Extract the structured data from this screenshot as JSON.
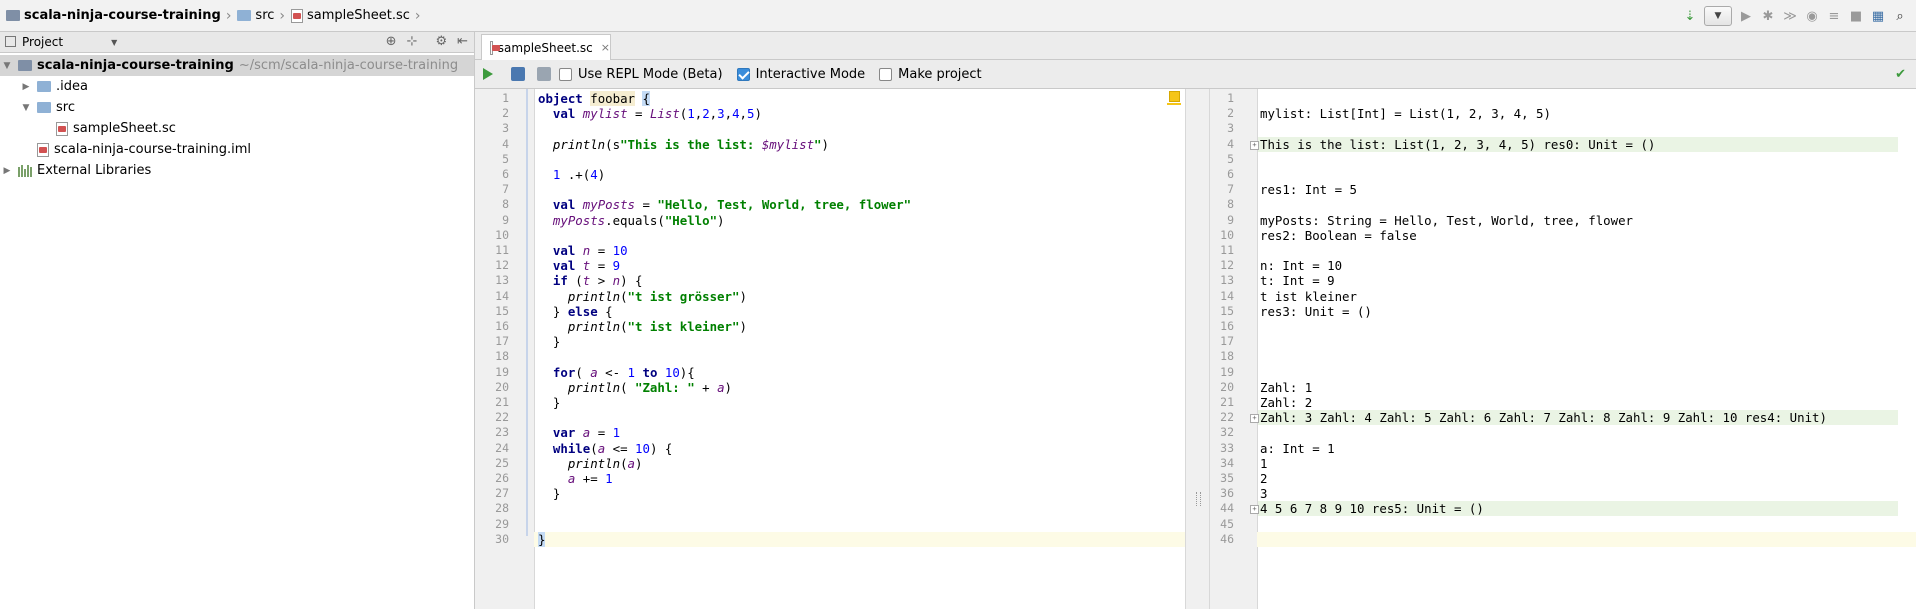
{
  "breadcrumb": {
    "project": "scala-ninja-course-training",
    "folder": "src",
    "file": "sampleSheet.sc"
  },
  "project_panel": {
    "title": "Project",
    "tree": [
      {
        "label": "scala-ninja-course-training",
        "path": "~/scm/scala-ninja-course-training",
        "icon": "project-folder-icon",
        "expanded": true
      },
      {
        "label": ".idea",
        "icon": "folder-icon",
        "expanded": false
      },
      {
        "label": "src",
        "icon": "folder-icon",
        "expanded": true
      },
      {
        "label": "sampleSheet.sc",
        "icon": "scala-worksheet-icon"
      },
      {
        "label": "scala-ninja-course-training.iml",
        "icon": "module-file-icon"
      },
      {
        "label": "External Libraries",
        "icon": "libraries-icon",
        "expanded": false
      }
    ]
  },
  "editor_tab": {
    "label": "sampleSheet.sc",
    "close": "×"
  },
  "worksheet_toolbar": {
    "repl_mode_label": "Use REPL Mode (Beta)",
    "repl_mode_checked": false,
    "interactive_mode_label": "Interactive Mode",
    "interactive_mode_checked": true,
    "make_project_label": "Make project",
    "make_project_checked": false
  },
  "source": {
    "line_numbers": [
      "1",
      "2",
      "3",
      "4",
      "5",
      "6",
      "7",
      "8",
      "9",
      "10",
      "11",
      "12",
      "13",
      "14",
      "15",
      "16",
      "17",
      "18",
      "19",
      "20",
      "21",
      "22",
      "23",
      "24",
      "25",
      "26",
      "27",
      "28",
      "29",
      "30"
    ],
    "lines": [
      "object foobar {",
      "  val mylist = List(1,2,3,4,5)",
      "",
      "  println(s\"This is the list: $mylist\")",
      "",
      "  1 .+(4)",
      "",
      "  val myPosts = \"Hello, Test, World, tree, flower\"",
      "  myPosts.equals(\"Hello\")",
      "",
      "  val n = 10",
      "  val t = 9",
      "  if (t > n) {",
      "    println(\"t ist grösser\")",
      "  } else {",
      "    println(\"t ist kleiner\")",
      "  }",
      "",
      "  for( a <- 1 to 10){",
      "    println( \"Zahl: \" + a)",
      "  }",
      "",
      "  var a = 1",
      "  while(a <= 10) {",
      "    println(a)",
      "    a += 1",
      "  }",
      "",
      "",
      "}"
    ]
  },
  "output": {
    "line_numbers": [
      "1",
      "2",
      "3",
      "4",
      "5",
      "6",
      "7",
      "8",
      "9",
      "10",
      "11",
      "12",
      "13",
      "14",
      "15",
      "16",
      "17",
      "18",
      "19",
      "20",
      "21",
      "22",
      "32",
      "33",
      "34",
      "35",
      "36",
      "44",
      "45",
      "46"
    ],
    "lines": [
      "",
      "mylist: List[Int] = List(1, 2, 3, 4, 5)",
      "",
      "This is the list: List(1, 2, 3, 4, 5) res0: Unit = ()",
      "",
      "",
      "res1: Int = 5",
      "",
      "myPosts: String = Hello, Test, World, tree, flower",
      "res2: Boolean = false",
      "",
      "n: Int = 10",
      "t: Int = 9",
      "t ist kleiner",
      "res3: Unit = ()",
      "",
      "",
      "",
      "",
      "Zahl: 1",
      "Zahl: 2",
      "Zahl: 3 Zahl: 4 Zahl: 5 Zahl: 6 Zahl: 7 Zahl: 8 Zahl: 9 Zahl: 10 res4: Unit)",
      "",
      "a: Int = 1",
      "1",
      "2",
      "3",
      "4 5 6 7 8 9 10 res5: Unit = ()",
      "",
      ""
    ]
  }
}
